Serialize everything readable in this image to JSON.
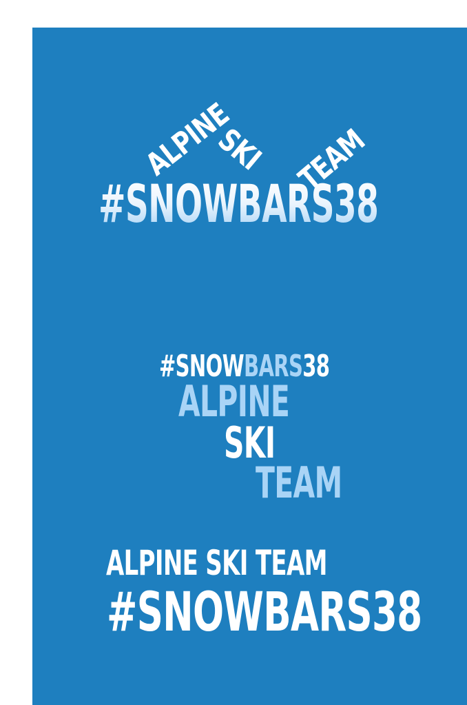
{
  "colors": {
    "background": "#1e7fbf",
    "white": "#ffffff",
    "light_blue": "#a9d4f6"
  },
  "logo1": {
    "word1": "ALPINE",
    "word2": "SKI",
    "word3": "TEAM",
    "hashtag": "#SNOWBARS38"
  },
  "logo2": {
    "hashtag_part1": "#SNOW",
    "hashtag_part2": "BARS",
    "hashtag_part3": "38",
    "word1": "ALPINE",
    "word2": "SKI",
    "word3": "TEAM"
  },
  "logo3": {
    "line1": "ALPINE SKI TEAM",
    "hashtag": "#SNOWBARS38"
  }
}
